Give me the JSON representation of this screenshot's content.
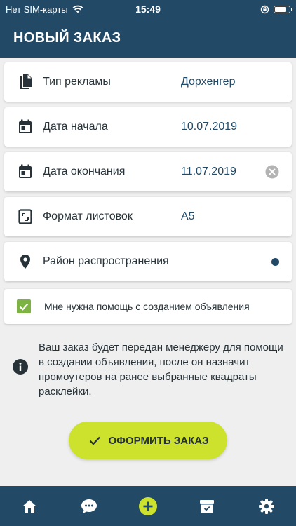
{
  "status_bar": {
    "carrier": "Нет SIM-карты",
    "time": "15:49"
  },
  "header": {
    "title": "НОВЫЙ ЗАКАЗ"
  },
  "form": {
    "ad_type": {
      "label": "Тип рекламы",
      "value": "Дорхенгер",
      "icon": "document-icon"
    },
    "start_date": {
      "label": "Дата начала",
      "value": "10.07.2019",
      "icon": "calendar-icon"
    },
    "end_date": {
      "label": "Дата окончания",
      "value": "11.07.2019",
      "icon": "calendar-icon"
    },
    "flyer_format": {
      "label": "Формат листовок",
      "value": "А5",
      "icon": "crop-frame-icon"
    },
    "district": {
      "label": "Район распространения",
      "icon": "location-pin-icon"
    },
    "help_checkbox": {
      "label": "Мне нужна помощь с созданием объявления",
      "checked": true
    }
  },
  "info": {
    "text": "Ваш заказ будет передан менеджеру для помощи в создании объявления, после он назначит промоутеров на ранее выбранные квадраты расклейки."
  },
  "submit_button": {
    "label": "ОФОРМИТЬ ЗАКАЗ"
  },
  "tabbar": {
    "items": [
      "home-icon",
      "chat-icon",
      "add-icon",
      "box-icon",
      "settings-icon"
    ],
    "active_color": "#cce22d"
  },
  "colors": {
    "primary": "#224a66",
    "accent": "#cce22d",
    "checkbox": "#7cb342"
  }
}
